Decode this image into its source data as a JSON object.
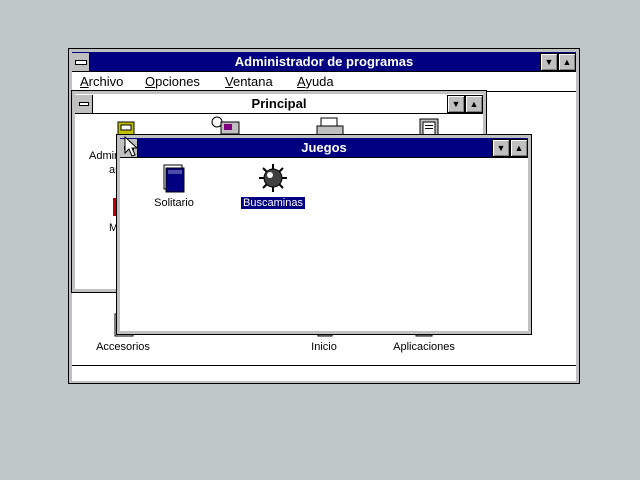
{
  "program_manager": {
    "title": "Administrador de programas",
    "menu": [
      {
        "first": "A",
        "rest": "rchivo"
      },
      {
        "first": "O",
        "rest": "pciones"
      },
      {
        "first": "V",
        "rest": "entana"
      },
      {
        "first": "A",
        "rest": "yuda"
      }
    ]
  },
  "principal": {
    "title": "Principal",
    "partial_labels": [
      "Admir",
      "ar",
      "M"
    ]
  },
  "juegos": {
    "title": "Juegos",
    "items": [
      {
        "label": "Solitario",
        "icon": "solitaire-icon",
        "selected": false
      },
      {
        "label": "Buscaminas",
        "icon": "minesweeper-icon",
        "selected": true
      }
    ]
  },
  "groups": [
    {
      "label": "Accesorios",
      "icon": "accessories-group-icon"
    },
    {
      "label": "Inicio",
      "icon": "startup-group-icon"
    },
    {
      "label": "Aplicaciones",
      "icon": "applications-group-icon"
    }
  ],
  "colors": {
    "desktop": "#c0c7c8",
    "titlebar_active": "#000080",
    "selection": "#000080"
  }
}
